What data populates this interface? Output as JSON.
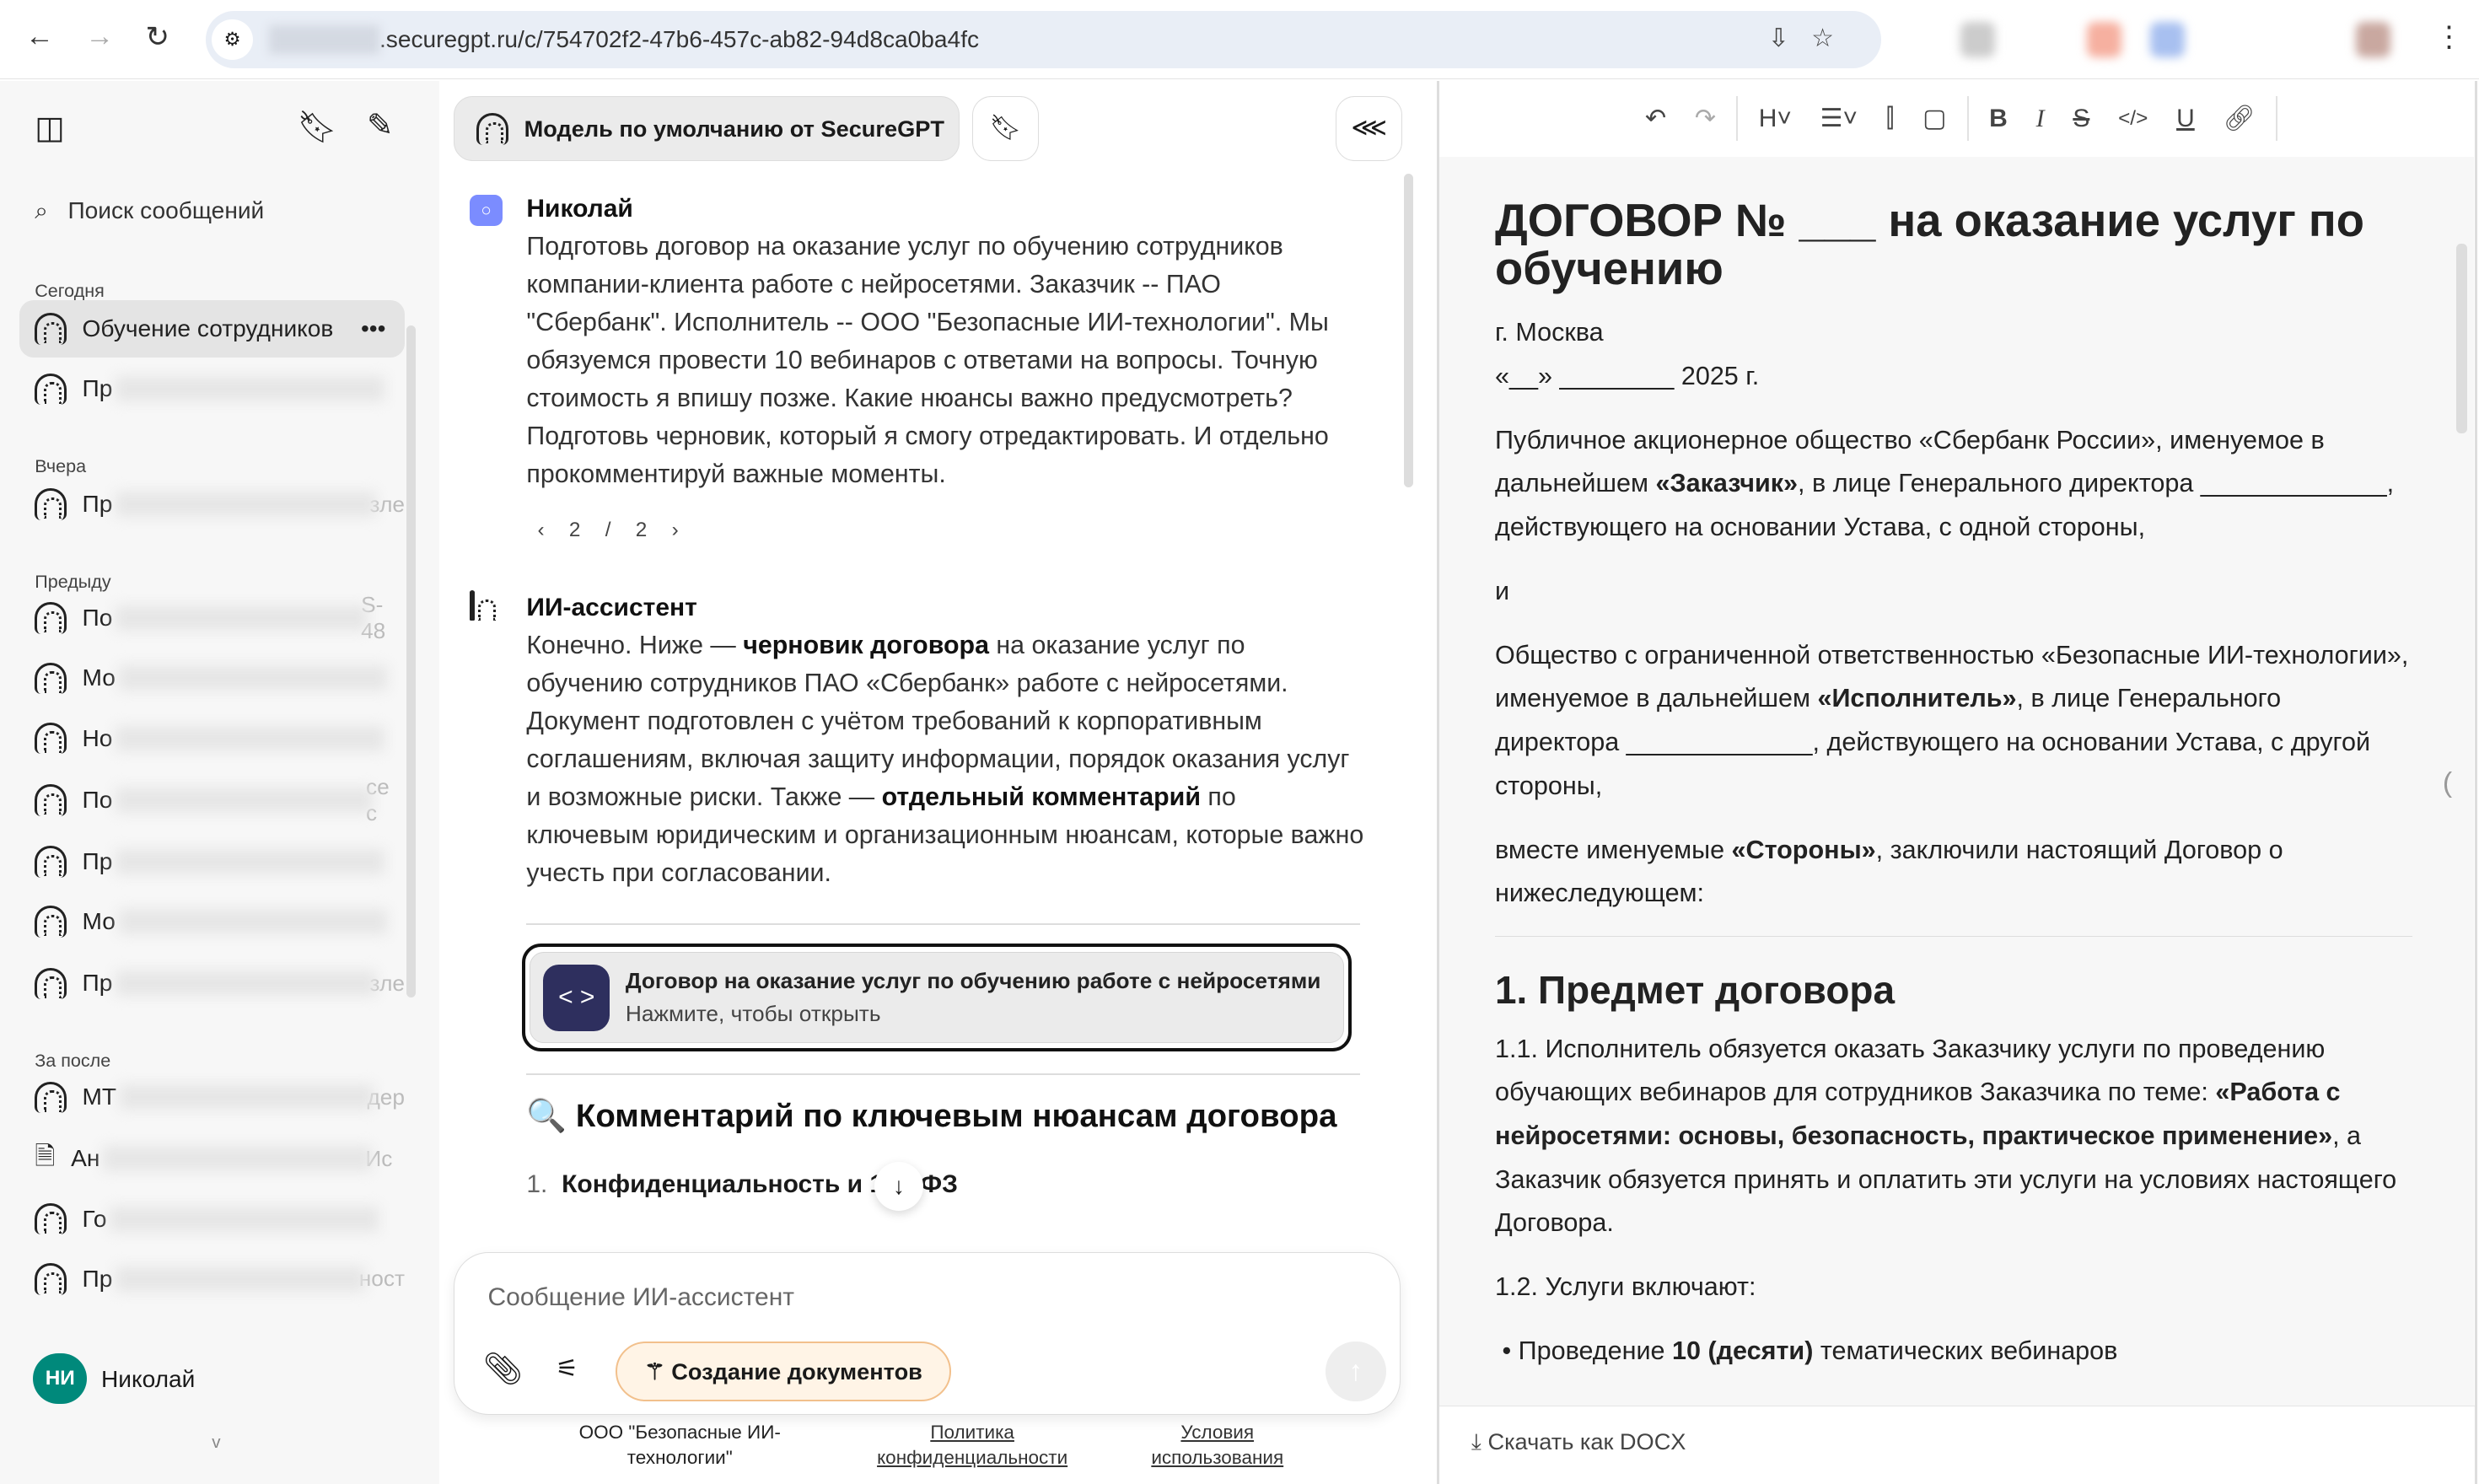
{
  "browser": {
    "url": ".securegpt.ru/c/754702f2-47b6-457c-ab82-94d8ca0ba4fc"
  },
  "sidebar": {
    "search_placeholder": "Поиск сообщений",
    "sections": [
      {
        "label": "Сегодня",
        "items": [
          {
            "label": "Обучение сотрудников",
            "tail": ""
          },
          {
            "label": "Пр",
            "tail": ""
          }
        ]
      },
      {
        "label": "Вчера",
        "items": [
          {
            "label": "Пр",
            "tail": "зле"
          }
        ]
      },
      {
        "label": "Предыду",
        "items": [
          {
            "label": "По",
            "tail": "S-48"
          },
          {
            "label": "Мо",
            "tail": ""
          },
          {
            "label": "Но",
            "tail": ""
          },
          {
            "label": "По",
            "tail": "се с"
          },
          {
            "label": "Пр",
            "tail": ""
          },
          {
            "label": "Мо",
            "tail": ""
          },
          {
            "label": "Пр",
            "tail": "зле"
          }
        ]
      },
      {
        "label": "За после",
        "items": [
          {
            "label": "МТ",
            "tail": "дер"
          },
          {
            "label": "Ан",
            "tail": "Ис"
          },
          {
            "label": "Го",
            "tail": ""
          },
          {
            "label": "Пр",
            "tail": "ност"
          }
        ]
      }
    ],
    "user": {
      "initials": "НИ",
      "name": "Николай"
    }
  },
  "chat": {
    "model_label": "Модель по умолчанию от SecureGPT",
    "user_name": "Николай",
    "user_message": "Подготовь договор на оказание услуг по обучению сотрудников компании-клиента работе с нейросетями. Заказчик -- ПАО \"Сбербанк\". Исполнитель -- ООО \"Безопасные ИИ-технологии\". Мы обязуемся провести 10 вебинаров с ответами на вопросы. Точную стоимость я впишу позже. Какие нюансы важно предусмотреть? Подготовь черновик, который я смогу отредактировать. И отдельно прокомментируй важные моменты.",
    "pager": "2 / 2",
    "assistant_name": "ИИ-ассистент",
    "assistant": {
      "a": "Конечно. Ниже — ",
      "b": "черновик договора",
      "c": " на оказание услуг по обучению сотрудников ПАО «Сбербанк» работе с нейросетями. Документ подготовлен с учётом требований к корпоративным соглашениям, включая защиту информации, порядок оказания услуг и возможные риски. Также — ",
      "d": "отдельный комментарий",
      "e": " по ключевым юридическим и организационным нюансам, которые важно учесть при согласовании."
    },
    "artifact": {
      "title": "Договор на оказание услуг по обучению работе с нейросетями",
      "subtitle": "Нажмите, чтобы открыть"
    },
    "comment_heading": "🔍 Комментарий по ключевым нюансам договора",
    "list_num": "1.",
    "list_item": "Конфиденциальность и 152-ФЗ",
    "composer": {
      "placeholder": "Сообщение ИИ-ассистент",
      "doc_button": "Создание документов"
    },
    "footer": {
      "company": "ООО \"Безопасные ИИ-технологии\"",
      "privacy": "Политика конфиденциальности",
      "terms": "Условия использования"
    }
  },
  "editor": {
    "title": "ДОГОВОР № ___ на оказание услуг по обучению",
    "city": "г. Москва",
    "date": "«__» ________ 2025 г.",
    "p1": {
      "a": "Публичное акционерное общество «Сбербанк России», именуемое в дальнейшем ",
      "b": "«Заказчик»",
      "c": ", в лице Генерального директора _____________, действующего на основании Устава, с одной стороны,"
    },
    "and": "и",
    "p2": {
      "a": "Общество с ограниченной ответственностью «Безопасные ИИ-технологии», именуемое в дальнейшем ",
      "b": "«Исполнитель»",
      "c": ", в лице Генерального директора _____________, действующего на основании Устава, с другой стороны,"
    },
    "p3": {
      "a": "вместе именуемые ",
      "b": "«Стороны»",
      "c": ", заключили настоящий Договор о нижеследующем:"
    },
    "h_section": "1. Предмет договора",
    "p4": {
      "a": "1.1. Исполнитель обязуется оказать Заказчику услуги по проведению обучающих вебинаров для сотрудников Заказчика по теме: ",
      "b": "«Работа с нейросетями: основы, безопасность, практическое применение»",
      "c": ", а Заказчик обязуется принять и оплатить эти услуги на условиях настоящего Договора."
    },
    "p5": "1.2. Услуги включают:",
    "bullet": {
      "a": "Проведение ",
      "b": "10 (десяти)",
      "c": " тематических вебинаров"
    },
    "download": "Скачать как DOCX"
  }
}
